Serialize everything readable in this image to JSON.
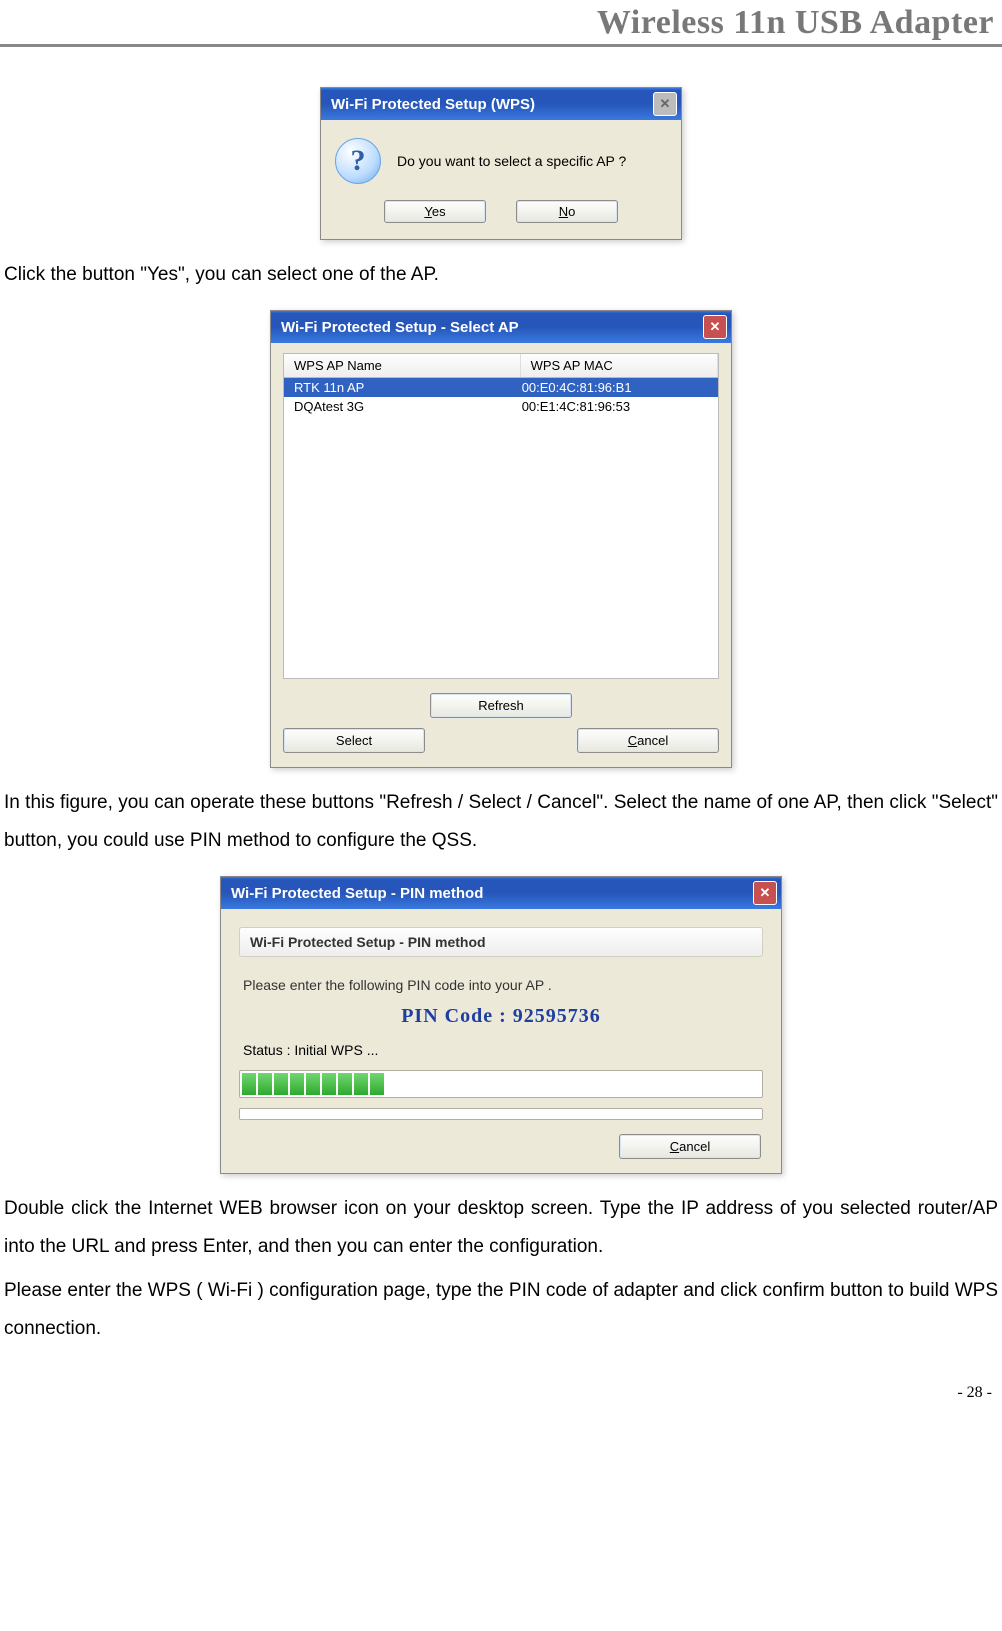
{
  "header": {
    "title": "Wireless 11n USB Adapter"
  },
  "dialog1": {
    "title": "Wi-Fi Protected Setup (WPS)",
    "message": "Do you want to select a specific AP ?",
    "yes": "Yes",
    "no": "No"
  },
  "text1": "Click the button \"Yes\", you can select one of the AP.",
  "dialog2": {
    "title": "Wi-Fi Protected Setup - Select AP",
    "col_name": "WPS AP Name",
    "col_mac": "WPS AP MAC",
    "rows": [
      {
        "name": "RTK 11n AP",
        "mac": "00:E0:4C:81:96:B1",
        "selected": true
      },
      {
        "name": "DQAtest 3G",
        "mac": "00:E1:4C:81:96:53",
        "selected": false
      }
    ],
    "refresh": "Refresh",
    "select": "Select",
    "cancel": "Cancel"
  },
  "text2": "In this figure, you can operate these buttons \"Refresh / Select / Cancel\". Select the name of one AP, then click \"Select\" button, you could use PIN method to configure the QSS.",
  "dialog3": {
    "title": "Wi-Fi Protected Setup - PIN method",
    "subtitle": "Wi-Fi Protected Setup - PIN method",
    "message": "Please enter the following PIN code into your AP .",
    "pin_label": "PIN Code :  92595736",
    "status": "Status :  Initial WPS ...",
    "progress_segments": 9,
    "cancel": "Cancel"
  },
  "text3": "Double click the Internet WEB browser icon on your desktop screen. Type the IP address of you selected router/AP into the URL and press Enter, and then you can enter the configuration.",
  "text4": "Please enter the WPS ( Wi-Fi ) configuration page, type the PIN code of adapter and click confirm button to build WPS connection.",
  "footer": {
    "page": "- 28 -"
  }
}
